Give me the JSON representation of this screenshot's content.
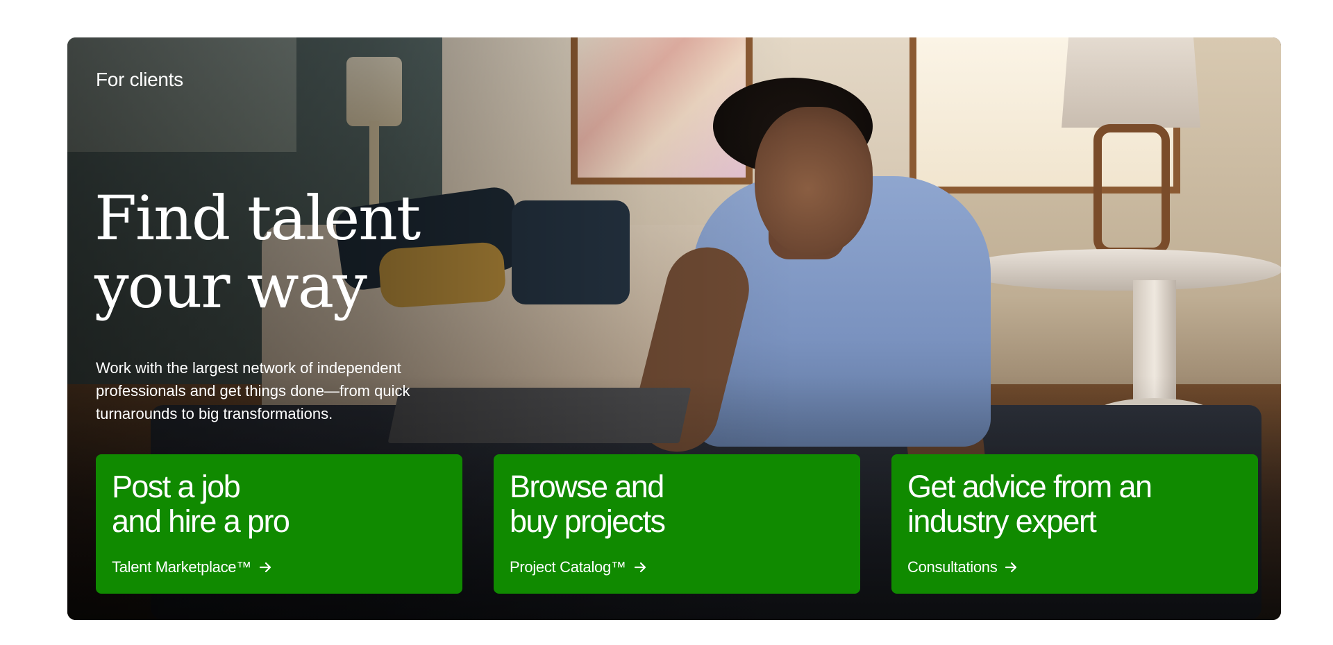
{
  "hero": {
    "eyebrow": "For clients",
    "headline_line1": "Find talent",
    "headline_line2": "your way",
    "subtext": "Work with the largest network of independent professionals and get things done—from quick turnarounds to big transformations.",
    "photo_icon": "person-working-on-laptop-photo"
  },
  "cards": [
    {
      "title_line1": "Post a job",
      "title_line2": "and hire a pro",
      "link_label": "Talent Marketplace™",
      "icon": "arrow-right-icon"
    },
    {
      "title_line1": "Browse and",
      "title_line2": "buy projects",
      "link_label": "Project Catalog™",
      "icon": "arrow-right-icon"
    },
    {
      "title_line1": "Get advice from an",
      "title_line2": "industry expert",
      "link_label": "Consultations",
      "icon": "arrow-right-icon"
    }
  ],
  "colors": {
    "card_green": "#108a00",
    "text_white": "#ffffff",
    "page_bg": "#ffffff"
  }
}
